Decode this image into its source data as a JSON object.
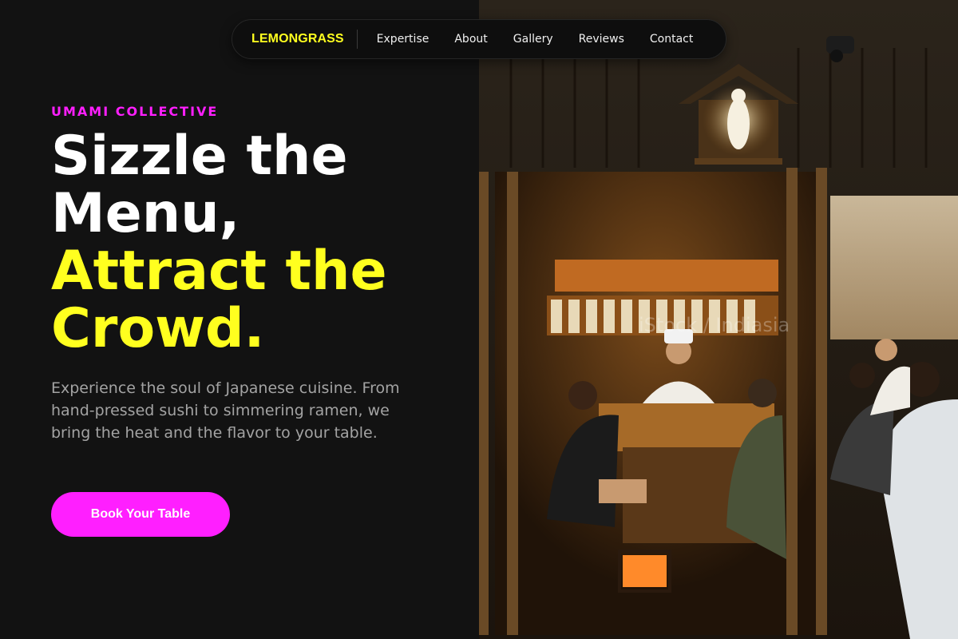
{
  "nav": {
    "brand": "LEMONGRASS",
    "links": [
      {
        "label": "Expertise"
      },
      {
        "label": "About"
      },
      {
        "label": "Gallery"
      },
      {
        "label": "Reviews"
      },
      {
        "label": "Contact"
      }
    ]
  },
  "hero": {
    "eyebrow": "UMAMI COLLECTIVE",
    "headline_line1": "Sizzle the",
    "headline_line2": "Menu,",
    "headline_line3": "Attract the",
    "headline_line4": "Crowd.",
    "description": "Experience the soul of Japanese cuisine. From hand-pressed sushi to simmering ramen, we bring the heat and the flavor to your table.",
    "cta_label": "Book Your Table"
  },
  "photo": {
    "watermark": "iStock / Indiasia"
  },
  "colors": {
    "background": "#121212",
    "accent_yellow": "#ffff1f",
    "accent_magenta": "#ff1fff",
    "body_text": "#a3a3a3"
  }
}
